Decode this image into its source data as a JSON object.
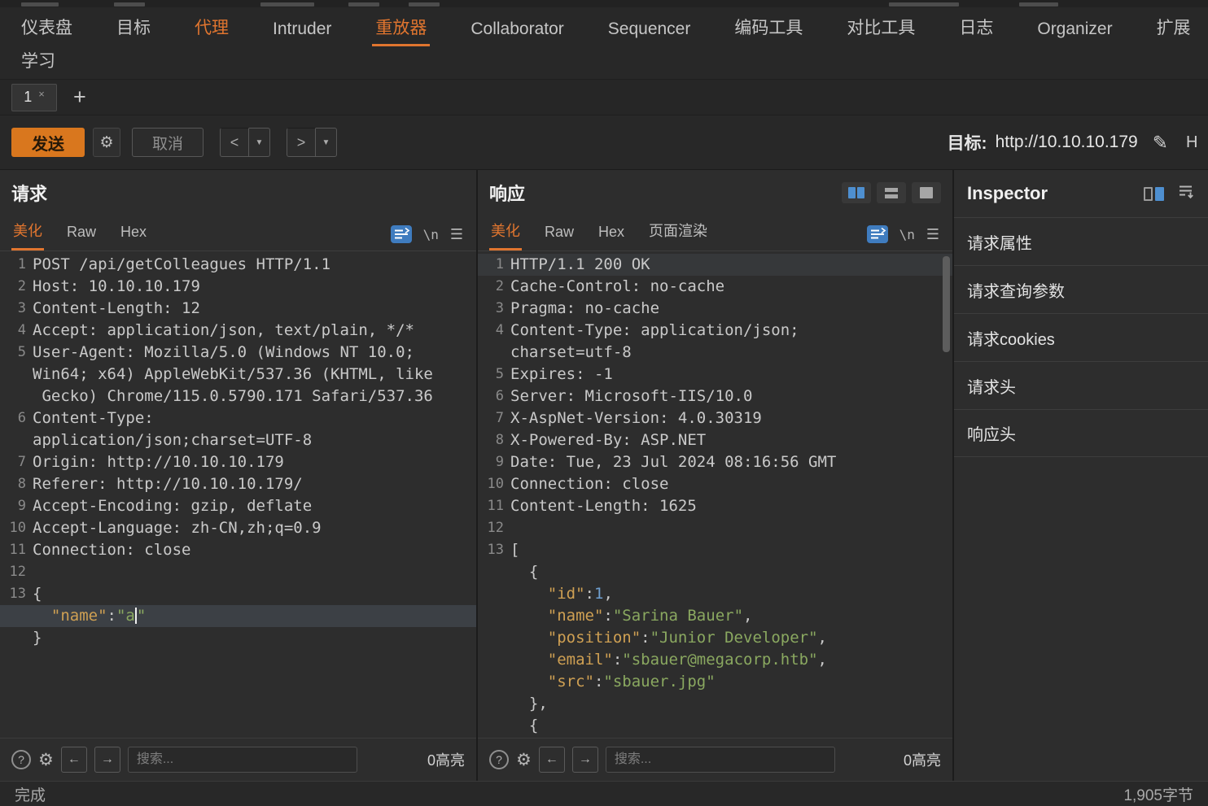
{
  "icons": {
    "gear": "⚙",
    "help": "?",
    "arrow_left": "←",
    "arrow_right": "→",
    "pencil": "✎",
    "caret_down": "▼",
    "close": "×",
    "add": "+",
    "newline": "\\n",
    "hamburger": "☰"
  },
  "colors": {
    "accent_orange": "#e0752f",
    "send_orange": "#d9771e",
    "icon_blue": "#3f7cbf",
    "selection_blue": "#4e8fd0",
    "json_key": "#cfa053",
    "json_string": "#8aa860",
    "json_number": "#6f9fd0",
    "editor_bg": "#2d2d2d"
  },
  "menubar": {
    "items": [
      {
        "label": "仪表盘"
      },
      {
        "label": "目标"
      },
      {
        "label": "代理"
      },
      {
        "label": "Intruder"
      },
      {
        "label": "重放器"
      },
      {
        "label": "Collaborator"
      },
      {
        "label": "Sequencer"
      },
      {
        "label": "编码工具"
      },
      {
        "label": "对比工具"
      },
      {
        "label": "日志"
      },
      {
        "label": "Organizer"
      },
      {
        "label": "扩展"
      }
    ],
    "row2_label": "学习",
    "active_item": "重放器",
    "accent_item": "代理"
  },
  "tabs": {
    "tab1": "1"
  },
  "toolbar": {
    "send": "发送",
    "cancel": "取消",
    "back": "<",
    "forward": ">",
    "target_label": "目标:",
    "target_url": "http://10.10.10.179",
    "right_fragment": "H"
  },
  "request": {
    "title": "请求",
    "tabs": [
      "美化",
      "Raw",
      "Hex"
    ],
    "search_placeholder": "搜索...",
    "highlights": "0高亮",
    "rows": [
      {
        "n": "1",
        "seg": [
          [
            "p",
            "POST /api/getColleagues HTTP/1.1"
          ]
        ]
      },
      {
        "n": "2",
        "seg": [
          [
            "p",
            "Host: 10.10.10.179"
          ]
        ]
      },
      {
        "n": "3",
        "seg": [
          [
            "p",
            "Content-Length: 12"
          ]
        ]
      },
      {
        "n": "4",
        "seg": [
          [
            "p",
            "Accept: application/json, text/plain, */*"
          ]
        ]
      },
      {
        "n": "5",
        "seg": [
          [
            "p",
            "User-Agent: Mozilla/5.0 (Windows NT 10.0;"
          ]
        ]
      },
      {
        "n": "",
        "seg": [
          [
            "p",
            "Win64; x64) AppleWebKit/537.36 (KHTML, like"
          ]
        ]
      },
      {
        "n": "",
        "seg": [
          [
            "p",
            " Gecko) Chrome/115.0.5790.171 Safari/537.36"
          ]
        ]
      },
      {
        "n": "6",
        "seg": [
          [
            "p",
            "Content-Type: "
          ]
        ]
      },
      {
        "n": "",
        "seg": [
          [
            "p",
            "application/json;charset=UTF-8"
          ]
        ]
      },
      {
        "n": "7",
        "seg": [
          [
            "p",
            "Origin: http://10.10.10.179"
          ]
        ]
      },
      {
        "n": "8",
        "seg": [
          [
            "p",
            "Referer: http://10.10.10.179/"
          ]
        ]
      },
      {
        "n": "9",
        "seg": [
          [
            "p",
            "Accept-Encoding: gzip, deflate"
          ]
        ]
      },
      {
        "n": "10",
        "seg": [
          [
            "p",
            "Accept-Language: zh-CN,zh;q=0.9"
          ]
        ]
      },
      {
        "n": "11",
        "seg": [
          [
            "p",
            "Connection: close"
          ]
        ]
      },
      {
        "n": "12",
        "seg": []
      },
      {
        "n": "13",
        "seg": [
          [
            "p",
            "{"
          ]
        ]
      },
      {
        "n": "",
        "hl": true,
        "seg": [
          [
            "p",
            "  "
          ],
          [
            "k",
            "\"name\""
          ],
          [
            "p",
            ":"
          ],
          [
            "s",
            "\"a"
          ],
          [
            "c",
            ""
          ],
          [
            "s",
            "\""
          ]
        ]
      },
      {
        "n": "",
        "seg": [
          [
            "p",
            "}"
          ]
        ]
      }
    ]
  },
  "response": {
    "title": "响应",
    "tabs": [
      "美化",
      "Raw",
      "Hex",
      "页面渲染"
    ],
    "search_placeholder": "搜索...",
    "highlights": "0高亮",
    "rows": [
      {
        "n": "1",
        "hl2": true,
        "seg": [
          [
            "p",
            "HTTP/1.1 200 OK"
          ]
        ]
      },
      {
        "n": "2",
        "seg": [
          [
            "p",
            "Cache-Control: no-cache"
          ]
        ]
      },
      {
        "n": "3",
        "seg": [
          [
            "p",
            "Pragma: no-cache"
          ]
        ]
      },
      {
        "n": "4",
        "seg": [
          [
            "p",
            "Content-Type: application/json;"
          ]
        ]
      },
      {
        "n": "",
        "seg": [
          [
            "p",
            "charset=utf-8"
          ]
        ]
      },
      {
        "n": "5",
        "seg": [
          [
            "p",
            "Expires: -1"
          ]
        ]
      },
      {
        "n": "6",
        "seg": [
          [
            "p",
            "Server: Microsoft-IIS/10.0"
          ]
        ]
      },
      {
        "n": "7",
        "seg": [
          [
            "p",
            "X-AspNet-Version: 4.0.30319"
          ]
        ]
      },
      {
        "n": "8",
        "seg": [
          [
            "p",
            "X-Powered-By: ASP.NET"
          ]
        ]
      },
      {
        "n": "9",
        "seg": [
          [
            "p",
            "Date: Tue, 23 Jul 2024 08:16:56 GMT"
          ]
        ]
      },
      {
        "n": "10",
        "seg": [
          [
            "p",
            "Connection: close"
          ]
        ]
      },
      {
        "n": "11",
        "seg": [
          [
            "p",
            "Content-Length: 1625"
          ]
        ]
      },
      {
        "n": "12",
        "seg": []
      },
      {
        "n": "13",
        "seg": [
          [
            "p",
            "["
          ]
        ]
      },
      {
        "n": "",
        "seg": [
          [
            "p",
            "  {"
          ]
        ]
      },
      {
        "n": "",
        "seg": [
          [
            "p",
            "    "
          ],
          [
            "k",
            "\"id\""
          ],
          [
            "p",
            ":"
          ],
          [
            "num",
            "1"
          ],
          [
            "p",
            ","
          ]
        ]
      },
      {
        "n": "",
        "seg": [
          [
            "p",
            "    "
          ],
          [
            "k",
            "\"name\""
          ],
          [
            "p",
            ":"
          ],
          [
            "s",
            "\"Sarina Bauer\""
          ],
          [
            "p",
            ","
          ]
        ]
      },
      {
        "n": "",
        "seg": [
          [
            "p",
            "    "
          ],
          [
            "k",
            "\"position\""
          ],
          [
            "p",
            ":"
          ],
          [
            "s",
            "\"Junior Developer\""
          ],
          [
            "p",
            ","
          ]
        ]
      },
      {
        "n": "",
        "seg": [
          [
            "p",
            "    "
          ],
          [
            "k",
            "\"email\""
          ],
          [
            "p",
            ":"
          ],
          [
            "s",
            "\"sbauer@megacorp.htb\""
          ],
          [
            "p",
            ","
          ]
        ]
      },
      {
        "n": "",
        "seg": [
          [
            "p",
            "    "
          ],
          [
            "k",
            "\"src\""
          ],
          [
            "p",
            ":"
          ],
          [
            "s",
            "\"sbauer.jpg\""
          ]
        ]
      },
      {
        "n": "",
        "seg": [
          [
            "p",
            "  },"
          ]
        ]
      },
      {
        "n": "",
        "seg": [
          [
            "p",
            "  {"
          ]
        ]
      }
    ]
  },
  "inspector": {
    "title": "Inspector",
    "sections": [
      "请求属性",
      "请求查询参数",
      "请求cookies",
      "请求头",
      "响应头"
    ]
  },
  "statusbar": {
    "status": "完成",
    "bytes": "1,905字节"
  }
}
